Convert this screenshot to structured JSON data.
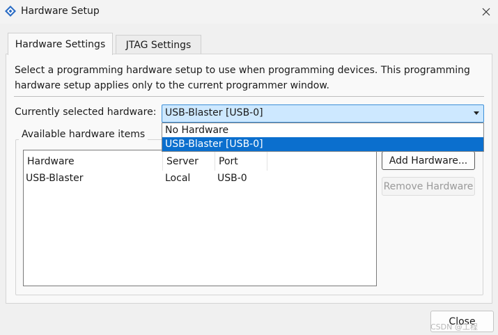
{
  "window": {
    "title": "Hardware Setup",
    "app_icon": "diamond-logo-icon",
    "close_icon": "close-icon"
  },
  "tabs": [
    {
      "label": "Hardware Settings",
      "active": true
    },
    {
      "label": "JTAG Settings",
      "active": false
    }
  ],
  "hardware_settings": {
    "description": "Select a programming hardware setup to use when programming devices. This programming hardware setup applies only to the current programmer window.",
    "current_label": "Currently selected hardware:",
    "current_value": "USB-Blaster [USB-0]",
    "dropdown_open": true,
    "dropdown_options": [
      "No Hardware",
      "USB-Blaster [USB-0]"
    ],
    "selected_option_index": 1,
    "available_group_label": "Available hardware items",
    "table": {
      "columns": [
        "Hardware",
        "Server",
        "Port"
      ],
      "rows": [
        [
          "USB-Blaster",
          "Local",
          "USB-0"
        ]
      ]
    },
    "add_button": "Add Hardware...",
    "remove_button": "Remove Hardware",
    "remove_disabled": true
  },
  "footer": {
    "close_button": "Close"
  },
  "watermark": "CSDN @工程",
  "colors": {
    "selection": "#0b6fce",
    "combo_focus": "#cde8ff",
    "combo_border": "#3c8fd8"
  }
}
